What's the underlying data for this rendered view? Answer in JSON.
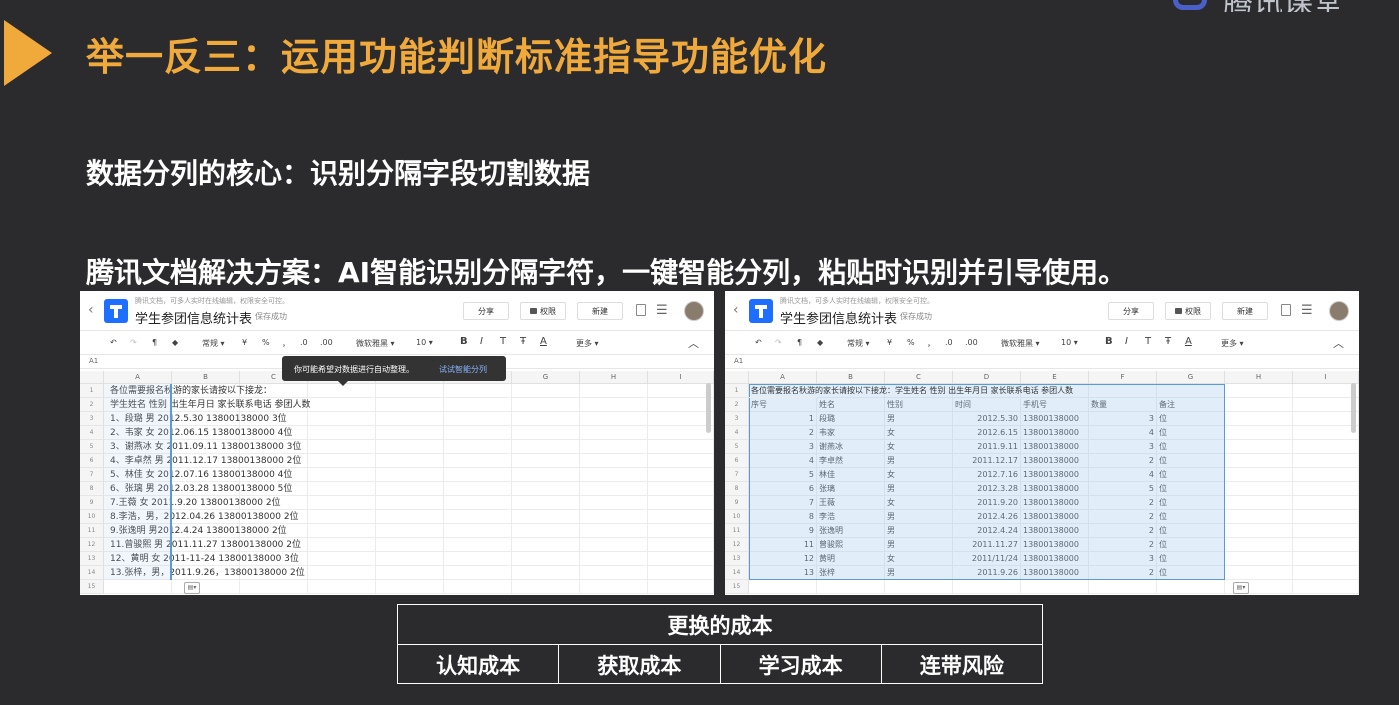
{
  "slide": {
    "title": "举一反三：运用功能判断标准指导功能优化",
    "subtitle1": "数据分列的核心：识别分隔字段切割数据",
    "subtitle2": "腾讯文档解决方案：AI智能识别分隔字符，一键智能分列，粘贴时识别并引导使用。",
    "corner_logo_text": "腾讯课堂"
  },
  "doc": {
    "hint": "腾讯文档，可多人实时在线编辑，权限安全可控。",
    "title": "学生参团信息统计表",
    "saved": "保存成功",
    "share": "分享",
    "permission": "权限",
    "new": "新建",
    "cell_ref": "A1",
    "toolbar": {
      "format": "常规",
      "currency": "¥",
      "percent": "%",
      "comma": "，",
      "dec_down": ".0",
      "dec_up": ".00",
      "font": "微软雅黑",
      "size": "10",
      "bold": "B",
      "italic": "I",
      "text_style": "T",
      "strike": "Ŧ",
      "color": "A",
      "more": "更多"
    },
    "col_headers": [
      "A",
      "B",
      "C",
      "D",
      "E",
      "F",
      "G",
      "H",
      "I"
    ],
    "row_numbers": [
      "1",
      "2",
      "3",
      "4",
      "5",
      "6",
      "7",
      "8",
      "9",
      "10",
      "11",
      "12",
      "13",
      "14",
      "15"
    ]
  },
  "left_sheet": {
    "popup_message": "你可能希望对数据进行自动整理。",
    "popup_action": "试试智能分列",
    "rows": [
      "各位需要报名秋游的家长请按以下接龙：",
      "学生姓名 性别 出生年月日 家长联系电话 参团人数",
      "1、段璐 男 2012.5.30 13800138000 3位",
      "2、韦家 女 2012.06.15 13800138000  4位",
      "3、谢燕冰 女 2011.09.11 13800138000    3位",
      "4、李卓然 男 2011.12.17  13800138000 2位",
      "5、林佳 女 2012.07.16  13800138000 4位",
      "6、张璃 男 2012.03.28 13800138000 5位",
      "7.王薇 女 2011.9.20    13800138000 2位",
      "8.李浩，男，2012.04.26  13800138000 2位",
      "9.张逸明   男2012.4.24  13800138000 2位",
      "11.曾骏熙   男   2011.11.27 13800138000 2位",
      "12、黄明 女  2011-11-24 13800138000    3位",
      "13.张梓，男，2011.9.26，13800138000  2位",
      ""
    ]
  },
  "right_sheet": {
    "row1": "各位需要报名秋游的家长请按以下接龙：学生姓名 性别 出生年月日 家长联系电话 参团人数",
    "headers": [
      "序号",
      "姓名",
      "性别",
      "时间",
      "手机号",
      "数量",
      "备注"
    ],
    "rows": [
      [
        "1",
        "段璐",
        "男",
        "2012.5.30",
        "13800138000",
        "3",
        "位"
      ],
      [
        "2",
        "韦家",
        "女",
        "2012.6.15",
        "13800138000",
        "4",
        "位"
      ],
      [
        "3",
        "谢燕冰",
        "女",
        "2011.9.11",
        "13800138000",
        "3",
        "位"
      ],
      [
        "4",
        "李卓然",
        "男",
        "2011.12.17",
        "13800138000",
        "2",
        "位"
      ],
      [
        "5",
        "林佳",
        "女",
        "2012.7.16",
        "13800138000",
        "4",
        "位"
      ],
      [
        "6",
        "张璃",
        "男",
        "2012.3.28",
        "13800138000",
        "5",
        "位"
      ],
      [
        "7",
        "王薇",
        "女",
        "2011.9.20",
        "13800138000",
        "2",
        "位"
      ],
      [
        "8",
        "李浩",
        "男",
        "2012.4.26",
        "13800138000",
        "2",
        "位"
      ],
      [
        "9",
        "张逸明",
        "男",
        "2012.4.24",
        "13800138000",
        "2",
        "位"
      ],
      [
        "11",
        "曾骏熙",
        "男",
        "2011.11.27",
        "13800138000",
        "2",
        "位"
      ],
      [
        "12",
        "黄明",
        "女",
        "2011/11/24",
        "13800138000",
        "3",
        "位"
      ],
      [
        "13",
        "张梓",
        "男",
        "2011.9.26",
        "13800138000",
        "2",
        "位"
      ]
    ]
  },
  "cost_table": {
    "header": "更换的成本",
    "cells": [
      "认知成本",
      "获取成本",
      "学习成本",
      "连带风险"
    ]
  }
}
